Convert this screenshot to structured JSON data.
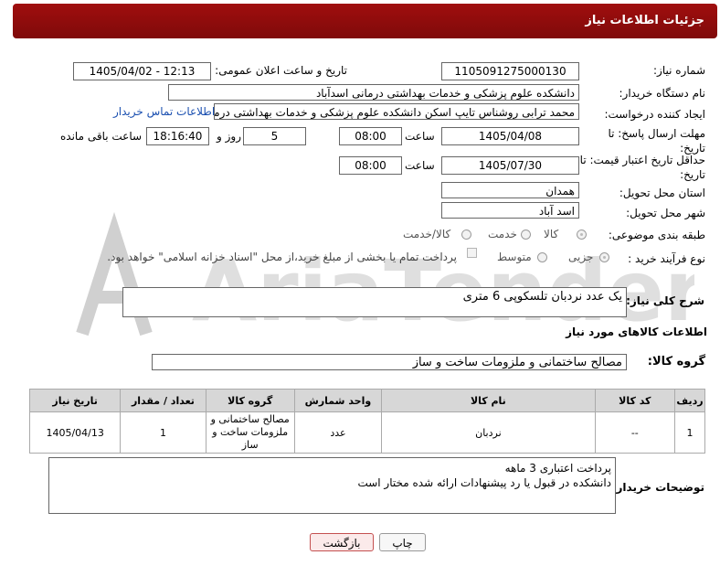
{
  "header": {
    "title": "جزئیات اطلاعات نیاز"
  },
  "watermark": {
    "text": "AriaTender.neT"
  },
  "fields": {
    "need_number_label": "شماره نیاز:",
    "need_number": "1105091275000130",
    "announce_label": "تاریخ و ساعت اعلان عمومی:",
    "announce_value": "1405/04/02 - 12:13",
    "buyer_org_label": "نام دستگاه خریدار:",
    "buyer_org": "دانشکده علوم پزشکی و خدمات بهداشتی درمانی اسدآباد",
    "creator_label": "ایجاد کننده درخواست:",
    "creator": "محمد ترابی روشناس تایپ اسکن دانشکده علوم پزشکی و خدمات بهداشتی درمانی",
    "contact_link": "اطلاعات تماس خریدار",
    "deadline_label": "مهلت ارسال پاسخ: تا تاریخ:",
    "deadline_date": "1405/04/08",
    "time_label": "ساعت",
    "deadline_time": "08:00",
    "days_value": "5",
    "days_label": "روز و",
    "remaining_time": "18:16:40",
    "remaining_label": "ساعت باقی مانده",
    "validity_label": "حداقل تاریخ اعتبار قیمت: تا تاریخ:",
    "validity_date": "1405/07/30",
    "validity_time": "08:00",
    "province_label": "استان محل تحویل:",
    "province": "همدان",
    "city_label": "شهر محل تحویل:",
    "city": "اسد آباد",
    "category_label": "طبقه بندی موضوعی:",
    "category_options": [
      "کالا",
      "خدمت",
      "کالا/خدمت"
    ],
    "process_label": "نوع فرآیند خرید :",
    "process_options": [
      "جزیی",
      "متوسط"
    ],
    "payment_note": "پرداخت تمام یا بخشی از مبلغ خرید،از محل \"اسناد خزانه اسلامی\" خواهد بود."
  },
  "description": {
    "label": "شرح کلی نیاز:",
    "text": "یک عدد نردبان تلسکوپی 6 متری"
  },
  "goods": {
    "section_title": "اطلاعات کالاهای مورد نیاز",
    "group_label": "گروه کالا:",
    "group_value": "مصالح ساختمانی و ملزومات ساخت و ساز",
    "columns": [
      "ردیف",
      "کد کالا",
      "نام کالا",
      "واحد شمارش",
      "گروه کالا",
      "تعداد / مقدار",
      "تاریخ نیاز"
    ],
    "rows": [
      {
        "row": "1",
        "code": "--",
        "name": "نردبان",
        "unit": "عدد",
        "group": "مصالح ساختمانی و ملزومات ساخت و ساز",
        "qty": "1",
        "date": "1405/04/13"
      }
    ]
  },
  "buyer_notes": {
    "label": "توضیحات خریدار:",
    "line1": "پرداخت اعتباری 3 ماهه",
    "line2": "دانشکده در قبول یا رد پیشنهادات ارائه شده مختار است"
  },
  "buttons": {
    "print": "چاپ",
    "back": "بازگشت"
  },
  "colors": {
    "header_bg": "#8b0c0c",
    "back_button_border": "#c45050",
    "watermark": "#c9c9c9"
  }
}
